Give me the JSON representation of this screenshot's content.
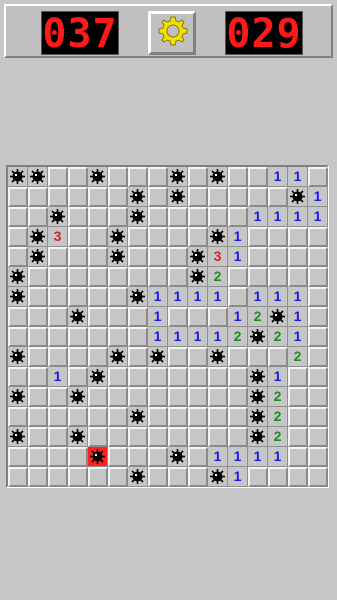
{
  "header": {
    "mines_counter": "037",
    "timer_counter": "029",
    "settings_icon": "gear-icon"
  },
  "colors": {
    "counter_text": "#ff1a1a",
    "number_1": "#1a1ae6",
    "number_2": "#1e8c1e",
    "number_3": "#e02020",
    "exploded": "#ff2020"
  },
  "board": {
    "rows": 16,
    "cols": 16,
    "grid": [
      "MM..M...M.M..11.",
      "......M.M.....M1",
      "..M...M.....1111",
      ".M3..M....M1....",
      ".M...M...M31....",
      "M........M2.....",
      "M.....M1111.111.",
      "...M...1...12M1.",
      ".......11112M21.",
      "M....M.M..M...2.",
      "..1.M.......M1..",
      "M..M........M2..",
      "......M.....M2..",
      "M..M........M2..",
      "....X...M.1111..",
      "......M...M1...."
    ],
    "legend": {
      ".": "unrevealed",
      "M": "mine",
      "X": "exploded-mine",
      "1": "number-1",
      "2": "number-2",
      "3": "number-3"
    }
  }
}
